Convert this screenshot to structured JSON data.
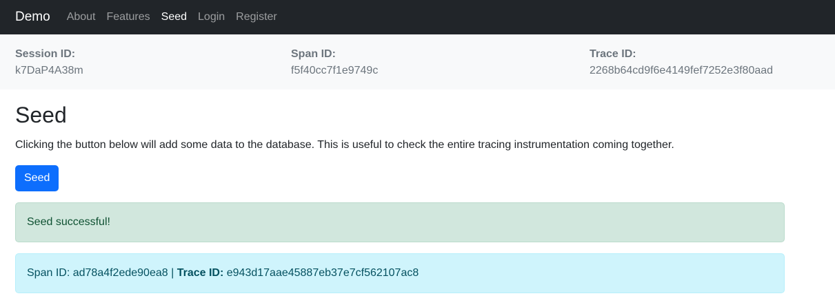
{
  "navbar": {
    "brand": "Demo",
    "links": [
      {
        "label": "About",
        "active": false
      },
      {
        "label": "Features",
        "active": false
      },
      {
        "label": "Seed",
        "active": true
      },
      {
        "label": "Login",
        "active": false
      },
      {
        "label": "Register",
        "active": false
      }
    ]
  },
  "ids": {
    "session_label": "Session ID:",
    "session_value": "k7DaP4A38m",
    "span_label": "Span ID:",
    "span_value": "f5f40cc7f1e9749c",
    "trace_label": "Trace ID:",
    "trace_value": "2268b64cd9f6e4149fef7252e3f80aad"
  },
  "main": {
    "title": "Seed",
    "description": "Clicking the button below will add some data to the database. This is useful to check the entire tracing instrumentation coming together.",
    "seed_button": "Seed"
  },
  "alerts": {
    "success_text": "Seed successful!",
    "info_span_label": "Span ID:",
    "info_span_value": "ad78a4f2ede90ea8",
    "info_separator": "|",
    "info_trace_label": "Trace ID:",
    "info_trace_value": "e943d17aae45887eb37e7cf562107ac8"
  },
  "colors": {
    "navbar_bg": "#212529",
    "primary": "#0d6efd",
    "success_bg": "#d1e7dd",
    "info_bg": "#cff4fc"
  }
}
